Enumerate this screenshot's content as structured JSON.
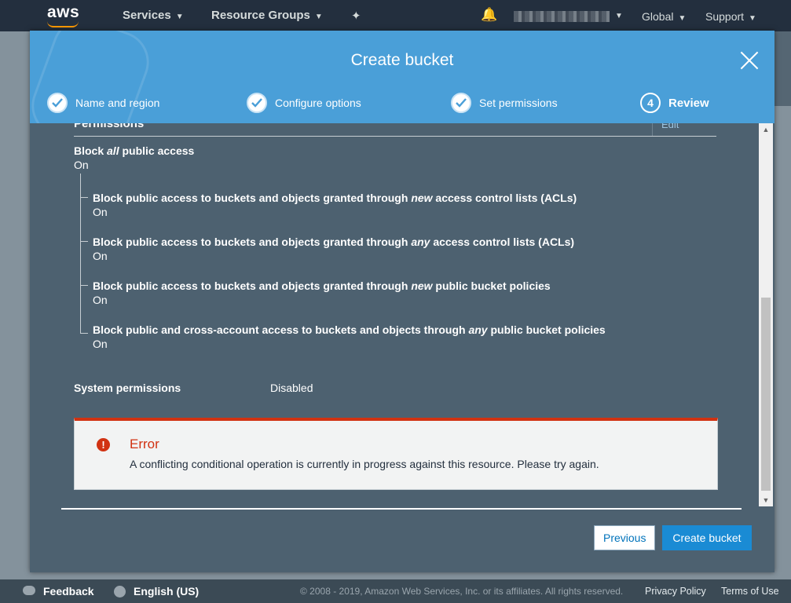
{
  "topnav": {
    "logo": "aws",
    "services": "Services",
    "resource_groups": "Resource Groups",
    "region": "Global",
    "support": "Support"
  },
  "modal": {
    "title": "Create bucket",
    "steps": [
      {
        "label": "Name and region",
        "state": "done"
      },
      {
        "label": "Configure options",
        "state": "done"
      },
      {
        "label": "Set permissions",
        "state": "done"
      },
      {
        "label": "Review",
        "number": "4",
        "state": "active"
      }
    ],
    "section_title": "Permissions",
    "edit_label": "Edit",
    "block_all": {
      "prefix": "Block ",
      "emphasis": "all",
      "suffix": " public access",
      "value": "On"
    },
    "sub_settings": [
      {
        "prefix": "Block public access to buckets and objects granted through ",
        "emphasis": "new",
        "suffix": " access control lists (ACLs)",
        "value": "On"
      },
      {
        "prefix": "Block public access to buckets and objects granted through ",
        "emphasis": "any",
        "suffix": " access control lists (ACLs)",
        "value": "On"
      },
      {
        "prefix": "Block public access to buckets and objects granted through ",
        "emphasis": "new",
        "suffix": " public bucket policies",
        "value": "On"
      },
      {
        "prefix": "Block public and cross-account access to buckets and objects through ",
        "emphasis": "any",
        "suffix": " public bucket policies",
        "value": "On"
      }
    ],
    "system_permissions": {
      "label": "System permissions",
      "value": "Disabled"
    },
    "error": {
      "icon": "!",
      "title": "Error",
      "message": "A conflicting conditional operation is currently in progress against this resource. Please try again."
    },
    "buttons": {
      "previous": "Previous",
      "create": "Create bucket"
    }
  },
  "bottombar": {
    "feedback": "Feedback",
    "language": "English (US)",
    "copyright": "© 2008 - 2019, Amazon Web Services, Inc. or its affiliates. All rights reserved.",
    "privacy": "Privacy Policy",
    "terms": "Terms of Use"
  },
  "colors": {
    "nav_bg": "#232f3e",
    "header_blue": "#4a9fd8",
    "modal_bg": "#4d6170",
    "error_red": "#d13212",
    "primary_button": "#1a8bd4"
  }
}
